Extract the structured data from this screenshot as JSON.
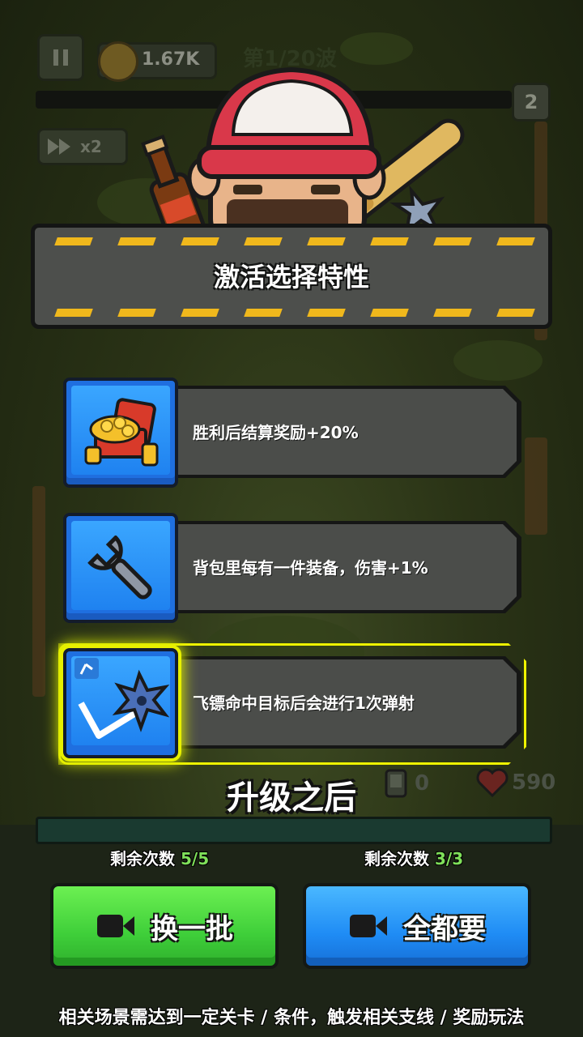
{
  "hud": {
    "coins": "1.67K",
    "wave": "第1/20波",
    "wave_number": "2",
    "speed": "x2"
  },
  "banner": {
    "title": "激活选择特性"
  },
  "traits": [
    {
      "icon": "treasure-chest-icon",
      "text": "胜利后结算奖励+20%",
      "selected": false
    },
    {
      "icon": "wrench-icon",
      "text": "背包里每有一件装备，伤害+1%",
      "selected": false
    },
    {
      "icon": "shuriken-bounce-icon",
      "text": "飞镖命中目标后会进行1次弹射",
      "selected": true
    }
  ],
  "upgrade_text": "升级之后",
  "stats": {
    "count": "0",
    "hp": "590"
  },
  "actions": {
    "reroll": {
      "remain_label": "剩余次数 ",
      "remain_count": "5/5",
      "label": "换一批"
    },
    "take_all": {
      "remain_label": "剩余次数 ",
      "remain_count": "3/3",
      "label": "全都要"
    }
  },
  "footer": "相关场景需达到一定关卡 / 条件，触发相关支线 / 奖励玩法",
  "colors": {
    "stripe": "#f0b81c",
    "green_button": "#3fcf3a",
    "blue_button": "#1f8cf5",
    "selected_glow": "#eef200"
  }
}
